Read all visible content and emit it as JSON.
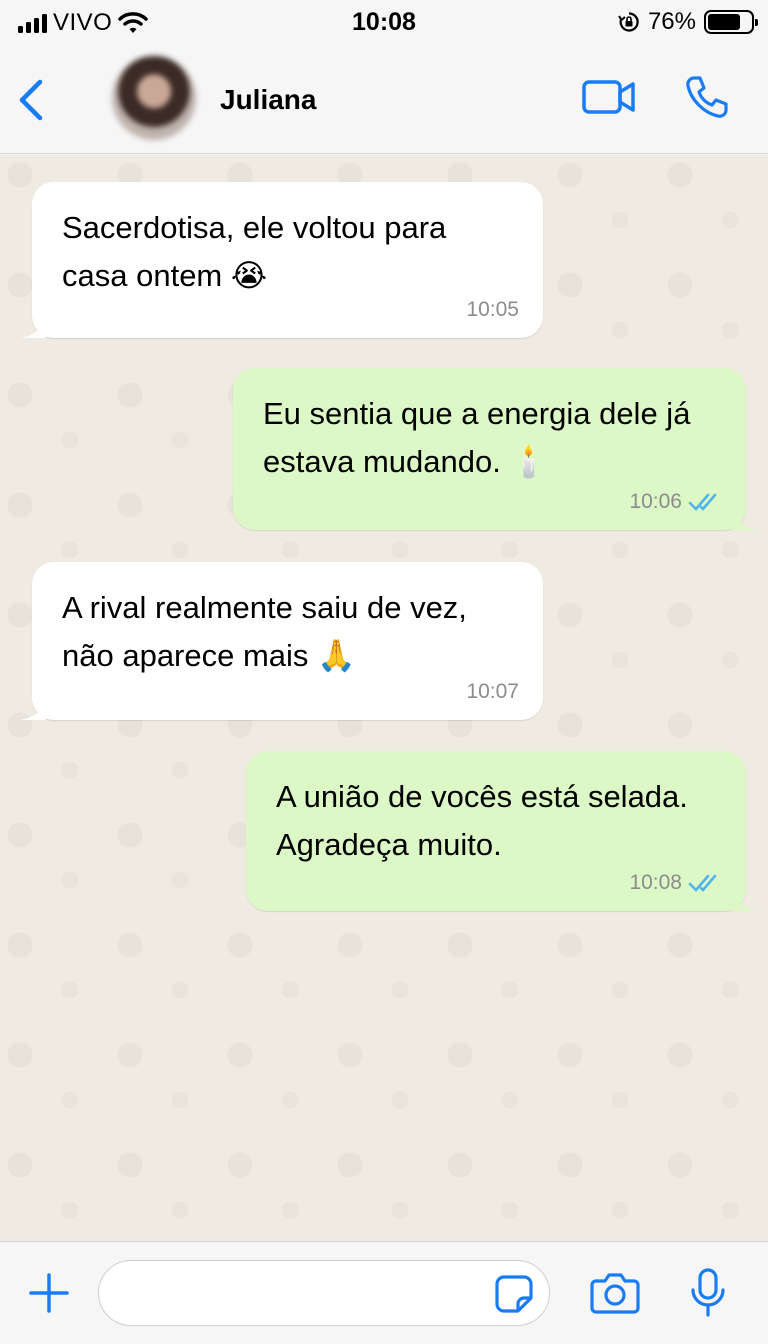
{
  "status_bar": {
    "carrier": "VIVO",
    "time": "10:08",
    "battery_percent": "76%",
    "battery_level": 0.76,
    "icons": [
      "signal-bars-icon",
      "wifi-icon",
      "orientation-lock-icon",
      "battery-icon"
    ]
  },
  "header": {
    "contact_name": "Juliana",
    "icons": [
      "back-chevron-icon",
      "video-call-icon",
      "phone-call-icon"
    ]
  },
  "messages": [
    {
      "direction": "incoming",
      "text": "Sacerdotisa, ele voltou para\ncasa ontem 😭",
      "time": "10:05"
    },
    {
      "direction": "outgoing",
      "text": "Eu sentia que a energia dele já\nestava mudando. 🕯️",
      "time": "10:06",
      "read": true
    },
    {
      "direction": "incoming",
      "text": "A rival realmente saiu de vez,\nnão aparece mais 🙏",
      "time": "10:07"
    },
    {
      "direction": "outgoing",
      "text": "A união de vocês está selada.\nAgradeça muito.",
      "time": "10:08",
      "read": true
    }
  ],
  "input_bar": {
    "message_value": "",
    "icons": [
      "plus-icon",
      "sticker-icon",
      "camera-icon",
      "microphone-icon"
    ]
  },
  "colors": {
    "accent": "#1a7cf5",
    "incoming_bubble": "#ffffff",
    "outgoing_bubble": "#dcf8c6",
    "chat_background": "#efeae2",
    "read_ticks": "#4fb6ec"
  }
}
